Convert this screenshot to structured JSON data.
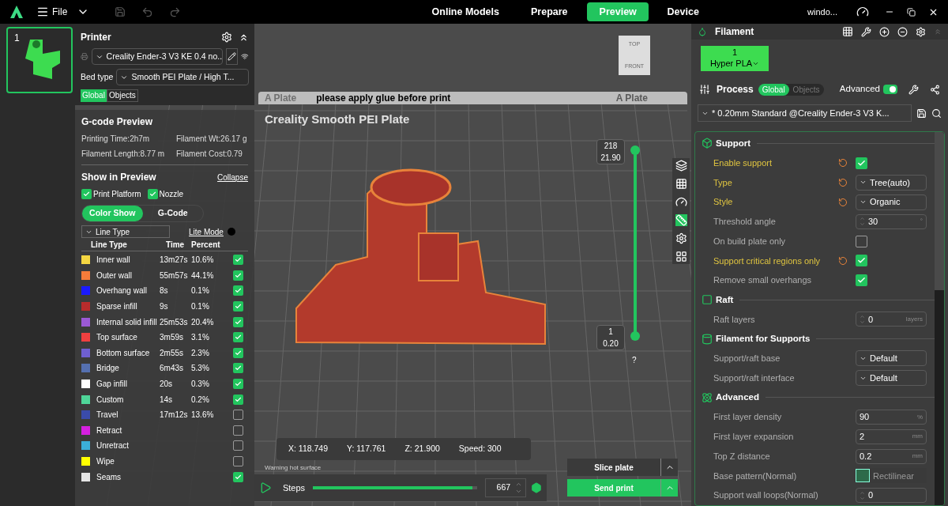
{
  "app_bar": {
    "menu": "File",
    "tabs": [
      {
        "label": "Online Models",
        "selected": false
      },
      {
        "label": "Prepare",
        "selected": false
      },
      {
        "label": "Preview",
        "selected": true
      },
      {
        "label": "Device",
        "selected": false
      }
    ],
    "window_label": "windo..."
  },
  "plates": [
    {
      "number": "1",
      "selected": true
    }
  ],
  "printer": {
    "title": "Printer",
    "preset": "Creality Ender-3 V3 KE 0.4 no..",
    "bed_type_label": "Bed type",
    "bed_type": "Smooth PEI Plate / High T...",
    "scope": [
      {
        "label": "Global",
        "selected": true
      },
      {
        "label": "Objects",
        "selected": false
      }
    ]
  },
  "gcode_preview": {
    "title": "G-code Preview",
    "stats": [
      "Printing Time:2h7m",
      "Filament Wt:26.17 g",
      "Filament Length:8.77 m",
      "Filament Cost:0.79"
    ]
  },
  "show_in_preview": {
    "title": "Show in Preview",
    "collapse": "Collapse",
    "options": [
      {
        "label": "Print Platform",
        "checked": true
      },
      {
        "label": "Nozzle",
        "checked": true
      }
    ],
    "modes": [
      {
        "label": "Color Show",
        "selected": true
      },
      {
        "label": "G-Code",
        "selected": false
      }
    ],
    "view_select": "Line Type",
    "lite_mode": "Lite Mode"
  },
  "legend": {
    "columns": [
      "Line Type",
      "Time",
      "Percent"
    ],
    "rows": [
      {
        "name": "Inner wall",
        "color": "#f5d742",
        "time": "13m27s",
        "percent": "10.6%",
        "checked": true
      },
      {
        "name": "Outer wall",
        "color": "#f57c3a",
        "time": "55m57s",
        "percent": "44.1%",
        "checked": true
      },
      {
        "name": "Overhang wall",
        "color": "#1a1aff",
        "time": "8s",
        "percent": "0.1%",
        "checked": true
      },
      {
        "name": "Sparse infill",
        "color": "#b82c2c",
        "time": "9s",
        "percent": "0.1%",
        "checked": true
      },
      {
        "name": "Internal solid infill",
        "color": "#9b59d6",
        "time": "25m53s",
        "percent": "20.4%",
        "checked": true
      },
      {
        "name": "Top surface",
        "color": "#f04040",
        "time": "3m59s",
        "percent": "3.1%",
        "checked": true
      },
      {
        "name": "Bottom surface",
        "color": "#6f5fd0",
        "time": "2m55s",
        "percent": "2.3%",
        "checked": true
      },
      {
        "name": "Bridge",
        "color": "#5570b0",
        "time": "6m43s",
        "percent": "5.3%",
        "checked": true
      },
      {
        "name": "Gap infill",
        "color": "#ffffff",
        "time": "20s",
        "percent": "0.3%",
        "checked": true
      },
      {
        "name": "Custom",
        "color": "#4fd699",
        "time": "14s",
        "percent": "0.2%",
        "checked": true
      },
      {
        "name": "Travel",
        "color": "#3a4bab",
        "time": "17m12s",
        "percent": "13.6%",
        "checked": false
      },
      {
        "name": "Retract",
        "color": "#d620e0",
        "checked": false
      },
      {
        "name": "Unretract",
        "color": "#3bafd9",
        "checked": false
      },
      {
        "name": "Wipe",
        "color": "#ffff00",
        "checked": false
      },
      {
        "name": "Seams",
        "color": "#e6e6e6",
        "checked": true
      }
    ]
  },
  "viewport": {
    "plate_labels": [
      "A Plate",
      "A Plate"
    ],
    "plate_notice": "please apply glue before print",
    "plate_name": "Creality Smooth PEI Plate",
    "view_cube": [
      "TOP",
      "FRONT"
    ],
    "layer_handles": [
      {
        "label": [
          "218",
          "21.90"
        ],
        "level": 1
      },
      {
        "label": [
          "1",
          "0.20"
        ],
        "level": 0
      }
    ],
    "help": "?",
    "bed_warning": "Warning hot surface",
    "coords": [
      "X: 118.749",
      "Y: 117.761",
      "Z: 21.900",
      "Speed: 300"
    ],
    "steps": {
      "label": "Steps",
      "level": 0.97,
      "value": "667"
    },
    "actions": [
      "Slice plate",
      "Send print"
    ]
  },
  "filament": {
    "title": "Filament",
    "slots": [
      {
        "number": "1",
        "name": "Hyper PLA"
      }
    ]
  },
  "process": {
    "title": "Process",
    "scope": [
      {
        "label": "Global",
        "selected": true
      },
      {
        "label": "Objects",
        "selected": false
      }
    ],
    "advanced_label": "Advanced",
    "advanced_on": true,
    "preset": "* 0.20mm Standard @Creality Ender-3 V3 K..."
  },
  "settings": [
    {
      "kind": "section",
      "title": "Support"
    },
    {
      "kind": "check",
      "label": "Enable support",
      "modified": true,
      "checked": true
    },
    {
      "kind": "select",
      "label": "Type",
      "modified": true,
      "value": "Tree(auto)"
    },
    {
      "kind": "select",
      "label": "Style",
      "modified": true,
      "value": "Organic"
    },
    {
      "kind": "spin",
      "label": "Threshold angle",
      "modified": false,
      "value": "30",
      "unit": "°"
    },
    {
      "kind": "check",
      "label": "On build plate only",
      "modified": false,
      "checked": false
    },
    {
      "kind": "check",
      "label": "Support critical regions only",
      "modified": true,
      "checked": true
    },
    {
      "kind": "check",
      "label": "Remove small overhangs",
      "modified": false,
      "checked": true
    },
    {
      "kind": "section",
      "title": "Raft"
    },
    {
      "kind": "spin",
      "label": "Raft layers",
      "modified": false,
      "value": "0",
      "unit": "layers"
    },
    {
      "kind": "section",
      "title": "Filament for Supports"
    },
    {
      "kind": "select",
      "label": "Support/raft base",
      "modified": false,
      "value": "Default"
    },
    {
      "kind": "select",
      "label": "Support/raft interface",
      "modified": false,
      "value": "Default"
    },
    {
      "kind": "section",
      "title": "Advanced"
    },
    {
      "kind": "input",
      "label": "First layer density",
      "modified": false,
      "value": "90",
      "unit": "%"
    },
    {
      "kind": "input",
      "label": "First layer expansion",
      "modified": false,
      "value": "2",
      "unit": "mm"
    },
    {
      "kind": "input",
      "label": "Top Z distance",
      "modified": false,
      "value": "0.2",
      "unit": "mm"
    },
    {
      "kind": "pattern",
      "label": "Base pattern(Normal)",
      "modified": false,
      "value": "Rectilinear"
    },
    {
      "kind": "spin",
      "label": "Support wall loops(Normal)",
      "modified": false,
      "value": "0"
    }
  ]
}
